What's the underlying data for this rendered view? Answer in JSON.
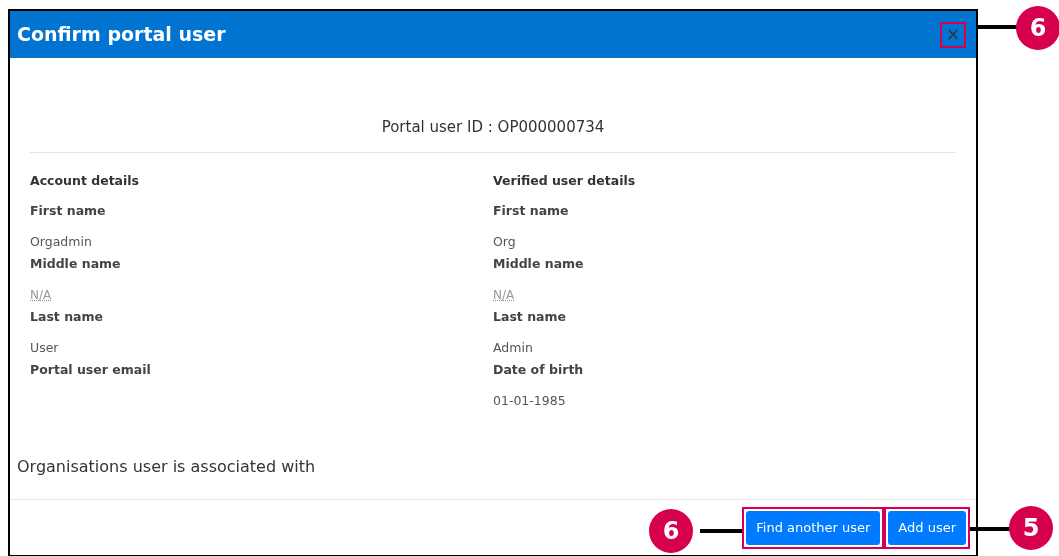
{
  "dialog": {
    "title": "Confirm portal user",
    "close": "×",
    "portal_user_id": "Portal user ID : OP000000734",
    "columns": [
      {
        "heading": "Account details",
        "fields": [
          {
            "label": "First name",
            "value": "Orgadmin",
            "missing": false
          },
          {
            "label": "Middle name",
            "value": "N/A",
            "missing": true
          },
          {
            "label": "Last name",
            "value": "User",
            "missing": false
          },
          {
            "label": "Portal user email"
          }
        ]
      },
      {
        "heading": "Verified user details",
        "fields": [
          {
            "label": "First name",
            "value": "Org",
            "missing": false
          },
          {
            "label": "Middle name",
            "value": "N/A",
            "missing": true
          },
          {
            "label": "Last name",
            "value": "Admin",
            "missing": false
          },
          {
            "label": "Date of birth",
            "value": "01-01-1985",
            "missing": false
          }
        ]
      }
    ],
    "organisations_heading": "Organisations user is associated with",
    "buttons": [
      "Find another user",
      "Add user"
    ]
  },
  "callouts": [
    {
      "label": "6"
    },
    {
      "label": "6"
    },
    {
      "label": "5"
    }
  ]
}
